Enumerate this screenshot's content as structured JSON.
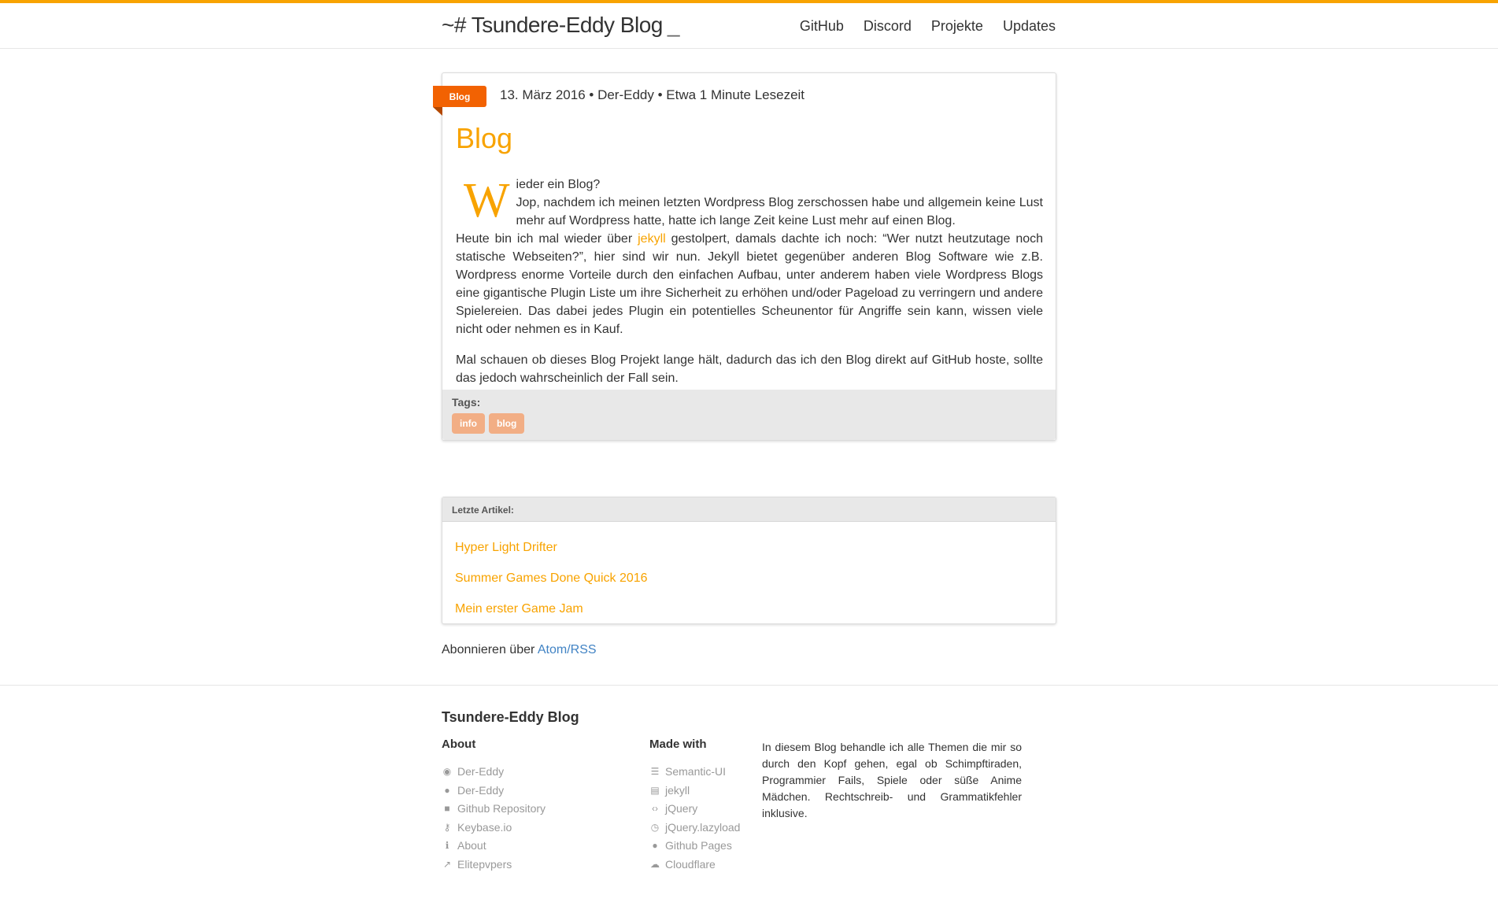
{
  "header": {
    "brand": "~# Tsundere-Eddy Blog",
    "cursor": "_",
    "nav": [
      "GitHub",
      "Discord",
      "Projekte",
      "Updates"
    ]
  },
  "post": {
    "category": "Blog",
    "meta": "13. März 2016 • Der-Eddy • Etwa 1 Minute Lesezeit",
    "title": "Blog",
    "dropcap": "W",
    "p1_a": "ieder ein Blog?",
    "p1_b": "Jop, nachdem ich meinen letzten Wordpress Blog zerschossen habe und allgemein keine Lust mehr auf Wordpress hatte, hatte ich lange Zeit keine Lust mehr auf einen Blog.",
    "p1_c_before": "Heute bin ich mal wieder über ",
    "p1_link": "jekyll",
    "p1_c_after": " gestolpert, damals dachte ich noch: “Wer nutzt heutzutage noch statische Webseiten?”, hier sind wir nun. Jekyll bietet gegenüber anderen Blog Software wie z.B. Wordpress enorme Vorteile durch den einfachen Aufbau, unter anderem haben viele Wordpress Blogs eine gigantische Plugin Liste um ihre Sicherheit zu erhöhen und/oder Pageload zu verringern und andere Spielereien. Das dabei jedes Plugin ein potentielles Scheunentor für Angriffe sein kann, wissen viele nicht oder nehmen es in Kauf.",
    "p2": "Mal schauen ob dieses Blog Projekt lange hält, dadurch das ich den Blog direkt auf GitHub hoste, sollte das jedoch wahrscheinlich der Fall sein.",
    "tags_label": "Tags:",
    "tags": [
      "info",
      "blog"
    ]
  },
  "recent": {
    "title": "Letzte Artikel:",
    "items": [
      "Hyper Light Drifter",
      "Summer Games Done Quick 2016",
      "Mein erster Game Jam"
    ]
  },
  "subscribe": {
    "text": "Abonnieren über ",
    "link": "Atom/RSS"
  },
  "footer": {
    "title": "Tsundere-Eddy Blog",
    "about_heading": "About",
    "about_links": [
      {
        "label": "Der-Eddy",
        "icon": "steam-icon"
      },
      {
        "label": "Der-Eddy",
        "icon": "github-icon"
      },
      {
        "label": "Github Repository",
        "icon": "github-square-icon"
      },
      {
        "label": "Keybase.io",
        "icon": "key-icon"
      },
      {
        "label": "About",
        "icon": "info-icon"
      },
      {
        "label": "Elitepvpers",
        "icon": "external-link-icon"
      }
    ],
    "made_heading": "Made with",
    "made_links": [
      {
        "label": "Semantic-UI",
        "icon": "css3-icon"
      },
      {
        "label": "jekyll",
        "icon": "html5-icon"
      },
      {
        "label": "jQuery",
        "icon": "code-icon"
      },
      {
        "label": "jQuery.lazyload",
        "icon": "clock-icon"
      },
      {
        "label": "Github Pages",
        "icon": "github-icon"
      },
      {
        "label": "Cloudflare",
        "icon": "cloud-icon"
      }
    ],
    "description": "In diesem Blog behandle ich alle Themen die mir so durch den Kopf gehen, egal ob Schimpftiraden, Programmier Fails, Spiele oder süße Anime Mädchen. Rechtschreib- und Grammatikfehler inklusive."
  },
  "colors": {
    "accent": "#f8a300",
    "ribbon": "#f26202",
    "tag": "#f2ae85",
    "link_blue": "#4183c4"
  }
}
